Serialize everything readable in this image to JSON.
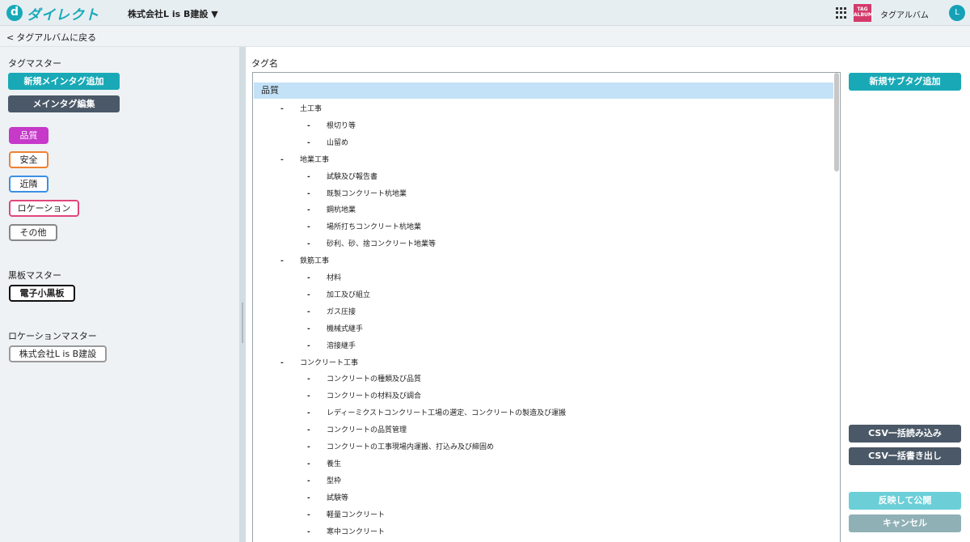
{
  "header": {
    "logo_letter": "d",
    "logo_text": "ダイレクト",
    "company": "株式会社L is B建設 ▼",
    "album_logo_text": "TAG ALBUM",
    "album_label": "タグアルバム",
    "avatar_initial": "L"
  },
  "backbar": {
    "back_label": "タグアルバムに戻る",
    "chevron": "<"
  },
  "sidebar": {
    "tag_master_title": "タグマスター",
    "add_main_tag": "新規メインタグ追加",
    "edit_main_tag": "メインタグ編集",
    "tags": [
      {
        "label": "品質",
        "color": "#c639c9",
        "selected": true
      },
      {
        "label": "安全",
        "color": "#f08132",
        "selected": false
      },
      {
        "label": "近隣",
        "color": "#3b8fe6",
        "selected": false
      },
      {
        "label": "ロケーション",
        "color": "#e0467a",
        "selected": false
      },
      {
        "label": "その他",
        "color": "#888888",
        "selected": false
      }
    ],
    "board_master_title": "黒板マスター",
    "board_button": "電子小黒板",
    "location_master_title": "ロケーションマスター",
    "location_button": "株式会社L is B建設"
  },
  "main": {
    "label": "タグ名",
    "root": "品質",
    "nodes": [
      {
        "level": 1,
        "label": "土工事"
      },
      {
        "level": 2,
        "label": "根切り等"
      },
      {
        "level": 2,
        "label": "山留め"
      },
      {
        "level": 1,
        "label": "地業工事"
      },
      {
        "level": 2,
        "label": "試験及び報告書"
      },
      {
        "level": 2,
        "label": "既製コンクリート杭地業"
      },
      {
        "level": 2,
        "label": "鋼杭地業"
      },
      {
        "level": 2,
        "label": "場所打ちコンクリート杭地業"
      },
      {
        "level": 2,
        "label": "砂利、砂、捨コンクリート地業等"
      },
      {
        "level": 1,
        "label": "鉄筋工事"
      },
      {
        "level": 2,
        "label": "材料"
      },
      {
        "level": 2,
        "label": "加工及び組立"
      },
      {
        "level": 2,
        "label": "ガス圧接"
      },
      {
        "level": 2,
        "label": "機械式継手"
      },
      {
        "level": 2,
        "label": "溶接継手"
      },
      {
        "level": 1,
        "label": "コンクリート工事"
      },
      {
        "level": 2,
        "label": "コンクリートの種類及び品質"
      },
      {
        "level": 2,
        "label": "コンクリートの材料及び調合"
      },
      {
        "level": 2,
        "label": "レディーミクストコンクリート工場の選定、コンクリートの製造及び運搬"
      },
      {
        "level": 2,
        "label": "コンクリートの品質管理"
      },
      {
        "level": 2,
        "label": "コンクリートの工事現場内運搬、打込み及び締固め"
      },
      {
        "level": 2,
        "label": "養生"
      },
      {
        "level": 2,
        "label": "型枠"
      },
      {
        "level": 2,
        "label": "試験等"
      },
      {
        "level": 2,
        "label": "軽量コンクリート"
      },
      {
        "level": 2,
        "label": "寒中コンクリート"
      }
    ]
  },
  "actions": {
    "add_sub_tag": "新規サブタグ追加",
    "csv_import": "CSV一括読み込み",
    "csv_export": "CSV一括書き出し",
    "publish": "反映して公開",
    "cancel": "キャンセル"
  },
  "colors": {
    "teal": "#19a9b6",
    "slate": "#4a5867",
    "publish_light": "#6ccfd8",
    "cancel_grey": "#8fb0b5"
  }
}
